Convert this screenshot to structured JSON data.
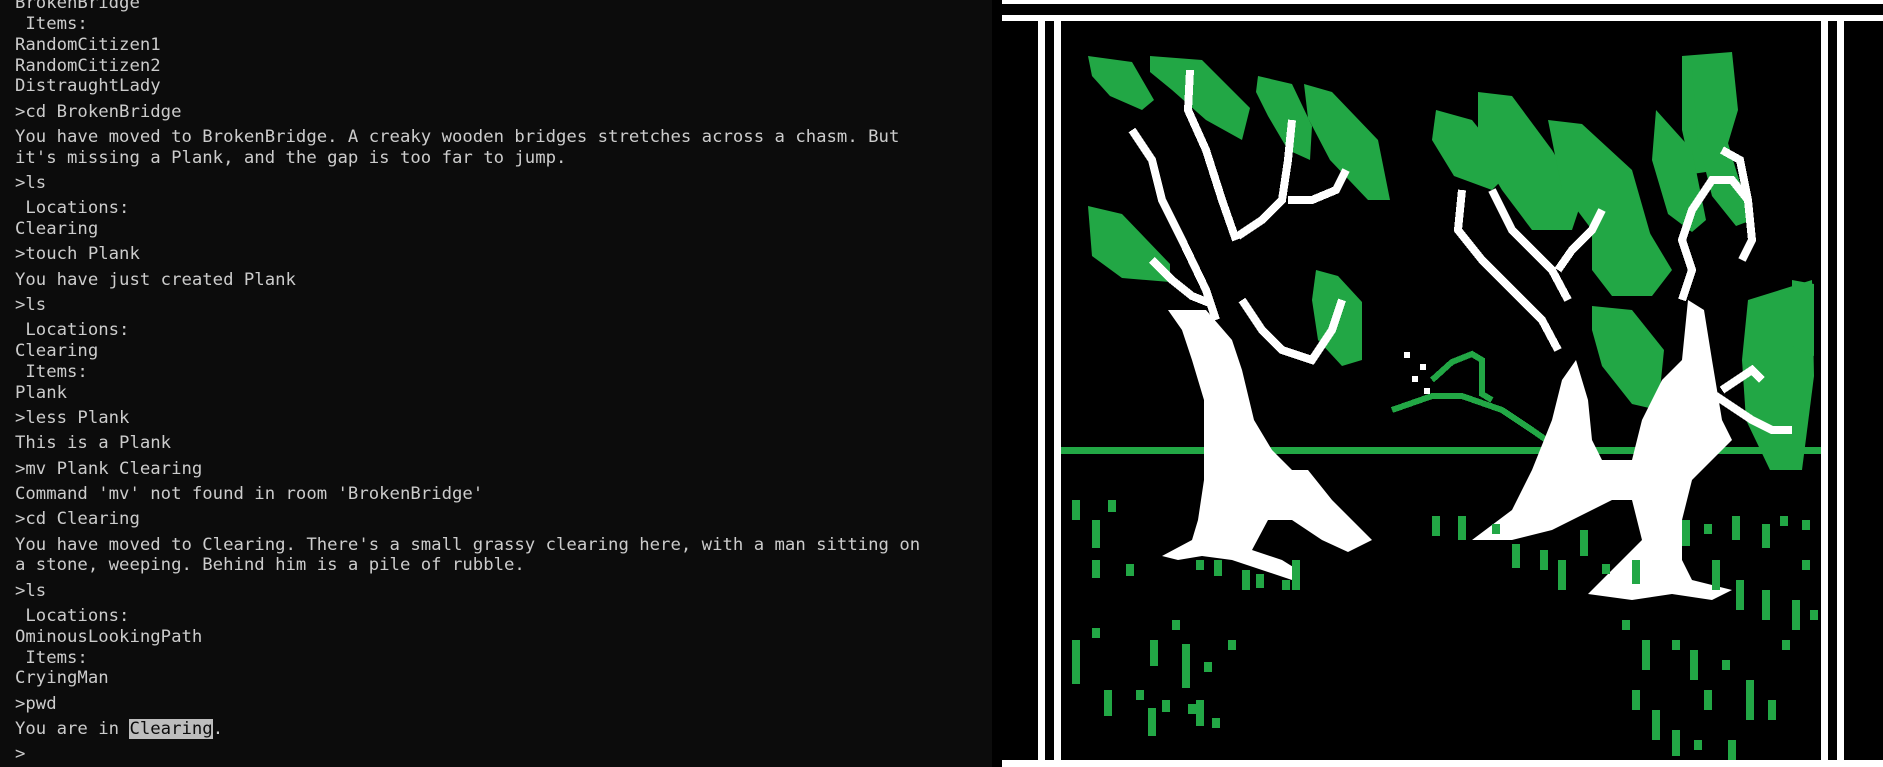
{
  "terminal": {
    "lines": [
      {
        "text": "BrokenBridge",
        "kind": "output"
      },
      {
        "text": " Items:",
        "kind": "output"
      },
      {
        "text": "RandomCitizen1",
        "kind": "output"
      },
      {
        "text": "RandomCitizen2",
        "kind": "output"
      },
      {
        "text": "DistraughtLady",
        "kind": "output"
      },
      {
        "text": ">cd BrokenBridge",
        "kind": "command"
      },
      {
        "text": "You have moved to BrokenBridge. A creaky wooden bridges stretches across a chasm. But",
        "kind": "output"
      },
      {
        "text": "it's missing a Plank, and the gap is too far to jump.",
        "kind": "output"
      },
      {
        "text": ">ls",
        "kind": "command"
      },
      {
        "text": " Locations:",
        "kind": "output"
      },
      {
        "text": "Clearing",
        "kind": "output"
      },
      {
        "text": ">touch Plank",
        "kind": "command"
      },
      {
        "text": "You have just created Plank",
        "kind": "output"
      },
      {
        "text": ">ls",
        "kind": "command"
      },
      {
        "text": " Locations:",
        "kind": "output"
      },
      {
        "text": "Clearing",
        "kind": "output"
      },
      {
        "text": " Items:",
        "kind": "output"
      },
      {
        "text": "Plank",
        "kind": "output"
      },
      {
        "text": ">less Plank",
        "kind": "command"
      },
      {
        "text": "This is a Plank",
        "kind": "output"
      },
      {
        "text": ">mv Plank Clearing",
        "kind": "command"
      },
      {
        "text": "Command 'mv' not found in room 'BrokenBridge'",
        "kind": "output"
      },
      {
        "text": ">cd Clearing",
        "kind": "command"
      },
      {
        "text": "You have moved to Clearing. There's a small grassy clearing here, with a man sitting on",
        "kind": "output"
      },
      {
        "text": "a stone, weeping. Behind him is a pile of rubble.",
        "kind": "output"
      },
      {
        "text": ">ls",
        "kind": "command"
      },
      {
        "text": " Locations:",
        "kind": "output"
      },
      {
        "text": "OminousLookingPath",
        "kind": "output"
      },
      {
        "text": " Items:",
        "kind": "output"
      },
      {
        "text": "CryingMan",
        "kind": "output"
      },
      {
        "text": ">pwd",
        "kind": "command"
      }
    ],
    "pwd_result": {
      "prefix": "You are in ",
      "highlight": "Clearing",
      "suffix": "."
    },
    "prompt": ">"
  },
  "art": {
    "scene": "pixel-art-forest-clearing",
    "colors": {
      "background": "#000000",
      "frame": "#ffffff",
      "leaves": "#22a745",
      "trunks": "#ffffff",
      "grass": "#22a745"
    }
  },
  "colors": {
    "terminal_bg": "#0c0c0c",
    "terminal_fg": "#cccccc",
    "selection_bg": "#bdbdbd"
  }
}
